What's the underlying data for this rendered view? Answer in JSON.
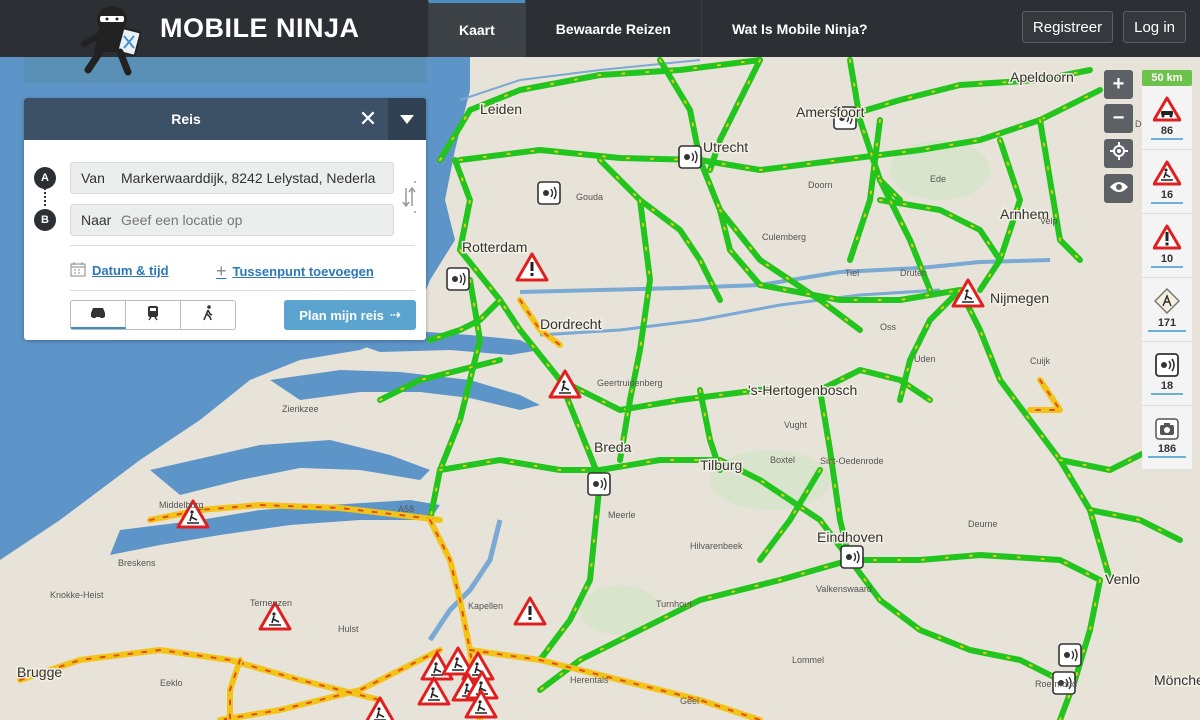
{
  "header": {
    "logo_text": "MOBILE NINJA",
    "nav": [
      {
        "label": "Kaart",
        "active": true
      },
      {
        "label": "Bewaarde Reizen",
        "active": false
      },
      {
        "label": "Wat Is Mobile Ninja?",
        "active": false
      }
    ],
    "register_label": "Registreer",
    "login_label": "Log in"
  },
  "route_panel": {
    "title": "Reis",
    "from": {
      "pin": "A",
      "label": "Van",
      "value": "Markerwaarddijk, 8242 Lelystad, Nederla"
    },
    "to": {
      "pin": "B",
      "label": "Naar",
      "placeholder": "Geef een locatie op"
    },
    "date_link": "Datum & tijd",
    "waypoint_link": "Tussenpunt toevoegen",
    "modes": [
      {
        "name": "car",
        "icon": "car-icon",
        "active": true
      },
      {
        "name": "train",
        "icon": "train-icon",
        "active": false
      },
      {
        "name": "walk",
        "icon": "walk-icon",
        "active": false
      }
    ],
    "plan_button": "Plan mijn reis"
  },
  "map_controls": {
    "zoom_in": "+",
    "zoom_out": "−"
  },
  "sidebar": {
    "scale": "50 km",
    "items": [
      {
        "icon": "traffic-warning-icon",
        "count": "86"
      },
      {
        "icon": "roadworks-icon",
        "count": "16"
      },
      {
        "icon": "warning-icon",
        "count": "10"
      },
      {
        "icon": "road-sign-icon",
        "count": "171"
      },
      {
        "icon": "speed-camera-icon",
        "count": "18"
      },
      {
        "icon": "camera-icon",
        "count": "186"
      }
    ]
  },
  "map": {
    "colors": {
      "road_green": "#22c51d",
      "road_yellow": "#f2c418",
      "water": "#5d95c9",
      "land": "#e8e3d8",
      "warning": "#e02020"
    },
    "city_labels": [
      "Apeldoorn",
      "Amersfoort",
      "Leiden",
      "Utrecht",
      "Gouda",
      "Doorn",
      "Ede",
      "Culemberg",
      "Arnhem",
      "Rotterdam",
      "Tiel",
      "Druten",
      "Nijmegen",
      "Dordrecht",
      "Zierikzee",
      "Geertruidenberg",
      "'s-Hertogenbosch",
      "Breda",
      "Tilburg",
      "Sint-Oedenrode",
      "Middelburg",
      "Breskens",
      "Terneuzen",
      "Kapellen",
      "Meerle",
      "Eindhoven",
      "Deurne",
      "Valkenswaard",
      "Venlo",
      "Turnhout",
      "Hulst",
      "Brugge",
      "Eeklo",
      "Knokke-Heist",
      "Lommel",
      "Geel",
      "Herentals",
      "Mönchengladbach",
      "Roermond",
      "Vught",
      "Uden",
      "Cuijk",
      "Oss",
      "Boxtel",
      "Hilvarenbeek",
      "Deventer",
      "Velp",
      "A58"
    ]
  }
}
